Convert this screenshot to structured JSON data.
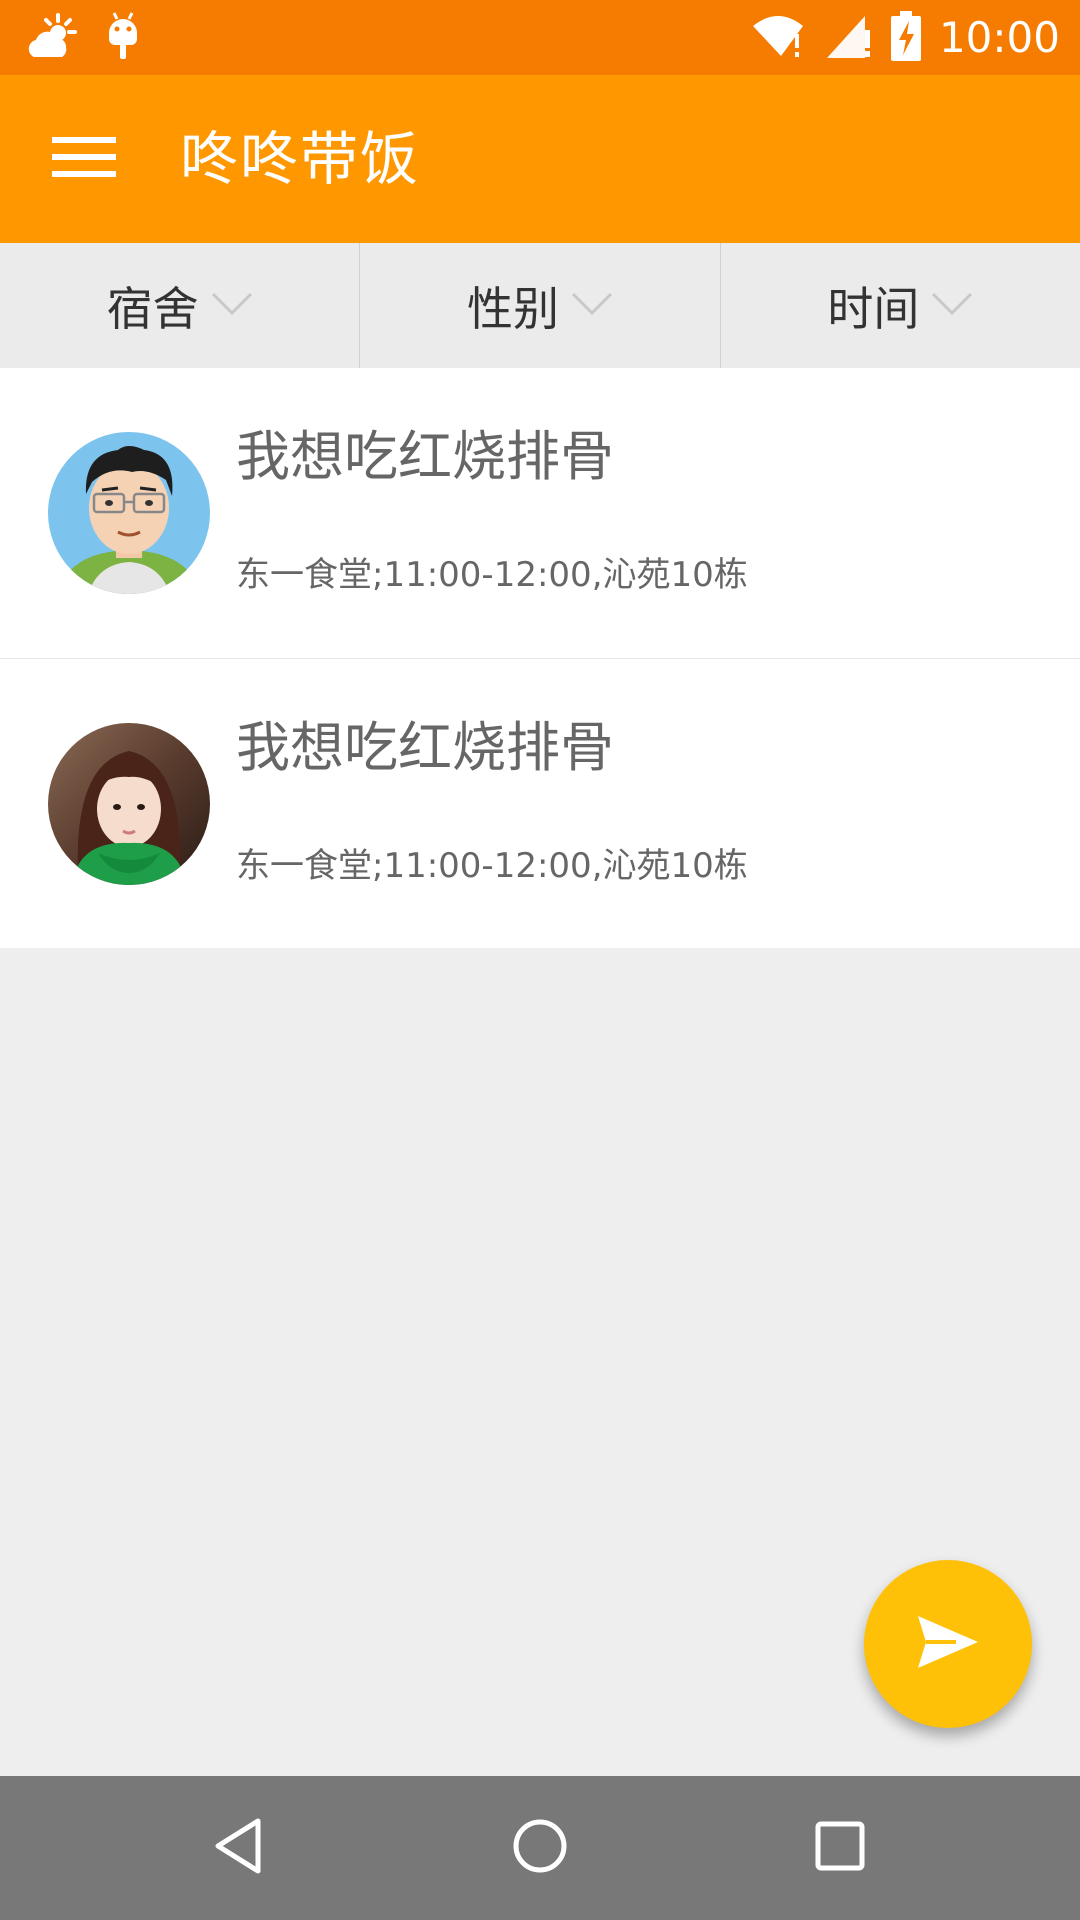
{
  "status_bar": {
    "time": "10:00",
    "left_icons": [
      "weather-icon",
      "android-debug-icon"
    ],
    "right_icons": [
      "wifi-alert-icon",
      "signal-alert-icon",
      "battery-charging-icon"
    ],
    "color": "#f57c00"
  },
  "app_bar": {
    "title": "咚咚带饭",
    "menu_icon": "menu-icon",
    "color": "#ff9800"
  },
  "filters": [
    {
      "label": "宿舍",
      "icon": "chevron-down-icon"
    },
    {
      "label": "性别",
      "icon": "chevron-down-icon"
    },
    {
      "label": "时间",
      "icon": "chevron-down-icon"
    }
  ],
  "posts": [
    {
      "title": "我想吃红烧排骨",
      "details": "东一食堂;11:00-12:00,沁苑10栋",
      "avatar": "cartoon-man-avatar"
    },
    {
      "title": "我想吃红烧排骨",
      "details": "东一食堂;11:00-12:00,沁苑10栋",
      "avatar": "girl-green-scarf-avatar"
    }
  ],
  "fab": {
    "icon": "send-icon",
    "color": "#ffc107"
  },
  "nav_bar": {
    "icons": [
      "back-icon",
      "home-icon",
      "recents-icon"
    ]
  }
}
